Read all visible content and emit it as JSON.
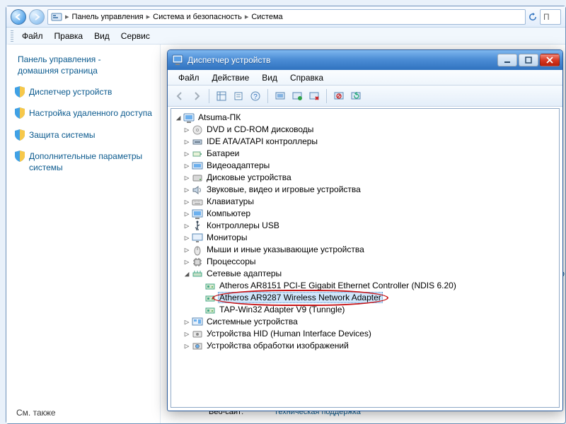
{
  "breadcrumb": [
    "Панель управления",
    "Система и безопасность",
    "Система"
  ],
  "search_placeholder": "П",
  "explorer_menu": [
    "Файл",
    "Правка",
    "Вид",
    "Сервис"
  ],
  "sidebar": {
    "head1": "Панель управления -",
    "head2": "домашняя страница",
    "items": [
      {
        "label": "Диспетчер устройств"
      },
      {
        "label": "Настройка удаленного доступа"
      },
      {
        "label": "Защита системы"
      },
      {
        "label": "Дополнительные параметры системы"
      }
    ]
  },
  "see_also": "См. также",
  "right_trunc": "і для этого",
  "footer_label": "Веб-сайт:",
  "footer_link": "Техническая поддержка",
  "dm": {
    "title": "Диспетчер устройств",
    "menu": [
      "Файл",
      "Действие",
      "Вид",
      "Справка"
    ],
    "root": "Atsuma-ПК",
    "nodes": [
      {
        "icon": "disc",
        "label": "DVD и CD-ROM дисководы"
      },
      {
        "icon": "ide",
        "label": "IDE ATA/ATAPI контроллеры"
      },
      {
        "icon": "bat",
        "label": "Батареи"
      },
      {
        "icon": "vid",
        "label": "Видеоадаптеры"
      },
      {
        "icon": "hdd",
        "label": "Дисковые устройства"
      },
      {
        "icon": "snd",
        "label": "Звуковые, видео и игровые устройства"
      },
      {
        "icon": "kbd",
        "label": "Клавиатуры"
      },
      {
        "icon": "pc",
        "label": "Компьютер"
      },
      {
        "icon": "usb",
        "label": "Контроллеры USB"
      },
      {
        "icon": "mon",
        "label": "Мониторы"
      },
      {
        "icon": "mse",
        "label": "Мыши и иные указывающие устройства"
      },
      {
        "icon": "cpu",
        "label": "Процессоры"
      }
    ],
    "net": {
      "label": "Сетевые адаптеры",
      "children": [
        {
          "label": "Atheros AR8151 PCI-E Gigabit Ethernet Controller (NDIS 6.20)"
        },
        {
          "label": "Atheros AR9287 Wireless Network Adapter",
          "selected": true,
          "circled": true
        },
        {
          "label": "TAP-Win32 Adapter V9 (Tunngle)"
        }
      ]
    },
    "nodes2": [
      {
        "icon": "sys",
        "label": "Системные устройства"
      },
      {
        "icon": "hid",
        "label": "Устройства HID (Human Interface Devices)"
      },
      {
        "icon": "img",
        "label": "Устройства обработки изображений"
      }
    ]
  }
}
